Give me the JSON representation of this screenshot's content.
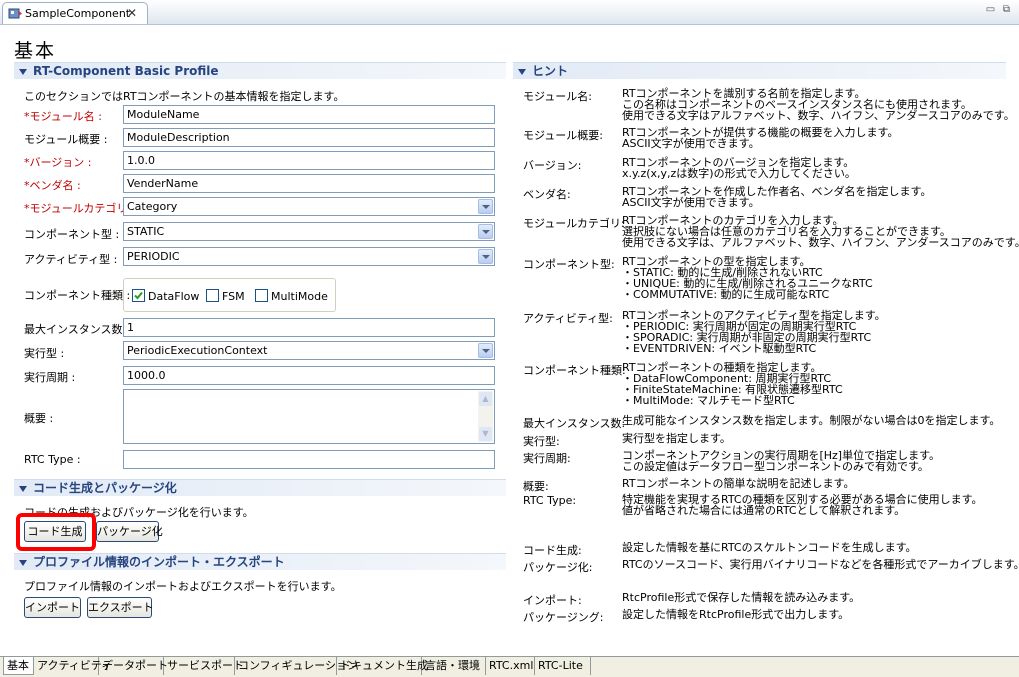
{
  "editor_tab": {
    "title": "SampleComponent"
  },
  "page_title": "基本",
  "profile": {
    "header": "RT-Component Basic Profile",
    "description": "このセクションではRTコンポーネントの基本情報を指定します。",
    "module_name": {
      "label": "*モジュール名 :",
      "value": "ModuleName"
    },
    "module_desc": {
      "label": "モジュール概要 :",
      "value": "ModuleDescription"
    },
    "version": {
      "label": "*バージョン :",
      "value": "1.0.0"
    },
    "vendor": {
      "label": "*ベンダ名 :",
      "value": "VenderName"
    },
    "category": {
      "label": "*モジュールカテゴリ :",
      "value": "Category"
    },
    "comp_type": {
      "label": "コンポーネント型 :",
      "value": "STATIC"
    },
    "activity_type": {
      "label": "アクティビティ型 :",
      "value": "PERIODIC"
    },
    "comp_kind": {
      "label": "コンポーネント種類 :",
      "options": [
        "DataFlow",
        "FSM",
        "MultiMode"
      ],
      "checked": [
        true,
        false,
        false
      ]
    },
    "max_instance": {
      "label": "最大インスタンス数 :",
      "value": "1"
    },
    "exec_type": {
      "label": "実行型 :",
      "value": "PeriodicExecutionContext"
    },
    "exec_rate": {
      "label": "実行周期 :",
      "value": "1000.0"
    },
    "abstract": {
      "label": "概要 :",
      "value": ""
    },
    "rtc_type": {
      "label": "RTC Type :",
      "value": ""
    }
  },
  "codegen": {
    "header": "コード生成とパッケージ化",
    "description": "コードの生成およびパッケージ化を行います。",
    "generate_label": "コード生成",
    "package_label": "パッケージ化",
    "highlight_color": "#ff0000"
  },
  "importexport": {
    "header": "プロファイル情報のインポート・エクスポート",
    "description": "プロファイル情報のインポートおよびエクスポートを行います。",
    "import_label": "インポート",
    "export_label": "エクスポート"
  },
  "hints": {
    "header": "ヒント",
    "items": [
      {
        "label": "モジュール名:",
        "lines": [
          "RTコンポーネントを識別する名前を指定します。",
          "この名称はコンポーネントのベースインスタンス名にも使用されます。",
          "使用できる文字はアルファベット、数字、ハイフン、アンダースコアのみです。"
        ]
      },
      {
        "label": "モジュール概要:",
        "lines": [
          "RTコンポーネントが提供する機能の概要を入力します。",
          "ASCII文字が使用できます。"
        ]
      },
      {
        "label": "バージョン:",
        "lines": [
          "RTコンポーネントのバージョンを指定します。",
          "x.y.z(x,y,zは数字)の形式で入力してください。"
        ]
      },
      {
        "label": "ベンダ名:",
        "lines": [
          "RTコンポーネントを作成した作者名、ベンダ名を指定します。",
          "ASCII文字が使用できます。"
        ]
      },
      {
        "label": "モジュールカテゴリ:",
        "lines": [
          "RTコンポーネントのカテゴリを入力します。",
          "選択肢にない場合は任意のカテゴリ名を入力することができます。",
          "使用できる文字は、アルファベット、数字、ハイフン、アンダースコアのみです。"
        ]
      },
      {
        "label": "コンポーネント型:",
        "lines": [
          "RTコンポーネントの型を指定します。",
          " ・STATIC: 動的に生成/削除されないRTC",
          " ・UNIQUE: 動的に生成/削除されるユニークなRTC",
          " ・COMMUTATIVE: 動的に生成可能なRTC"
        ]
      },
      {
        "label": "アクティビティ型:",
        "lines": [
          "RTコンポーネントのアクティビティ型を指定します。",
          " ・PERIODIC: 実行周期が固定の周期実行型RTC",
          " ・SPORADIC: 実行周期が非固定の周期実行型RTC",
          " ・EVENTDRIVEN: イベント駆動型RTC"
        ]
      },
      {
        "label": "コンポーネント種類:",
        "lines": [
          "RTコンポーネントの種類を指定します。",
          " ・DataFlowComponent: 周期実行型RTC",
          " ・FiniteStateMachine: 有限状態遷移型RTC",
          " ・MultiMode: マルチモード型RTC"
        ]
      },
      {
        "label": "最大インスタンス数:",
        "lines": [
          "生成可能なインスタンス数を指定します。制限がない場合は0を指定します。"
        ]
      },
      {
        "label": "実行型:",
        "lines": [
          "実行型を指定します。"
        ]
      },
      {
        "label": "実行周期:",
        "lines": [
          "コンポーネントアクションの実行周期を[Hz]単位で指定します。",
          "この設定値はデータフロー型コンポーネントのみで有効です。"
        ]
      },
      {
        "label": "概要:",
        "lines": [
          "RTコンポーネントの簡単な説明を記述します。"
        ]
      },
      {
        "label": "RTC Type:",
        "lines": [
          "特定機能を実現するRTCの種類を区別する必要がある場合に使用します。",
          "値が省略された場合には通常のRTCとして解釈されます。"
        ]
      },
      {
        "label": "コード生成:",
        "lines": [
          "設定した情報を基にRTCのスケルトンコードを生成します。"
        ]
      },
      {
        "label": "パッケージ化:",
        "lines": [
          "RTCのソースコード、実行用バイナリコードなどを各種形式でアーカイブします。"
        ]
      },
      {
        "label": "インポート:",
        "lines": [
          "RtcProfile形式で保存した情報を読み込みます。"
        ]
      },
      {
        "label": "パッケージング:",
        "lines": [
          "設定した情報をRtcProfile形式で出力します。"
        ]
      }
    ]
  },
  "bottom_tabs": [
    "基本",
    "アクティビティ",
    "データポート",
    "サービスポート",
    "コンフィギュレーション",
    "ドキュメント生成",
    "言語・環境",
    "RTC.xml",
    "RTC-Lite"
  ]
}
